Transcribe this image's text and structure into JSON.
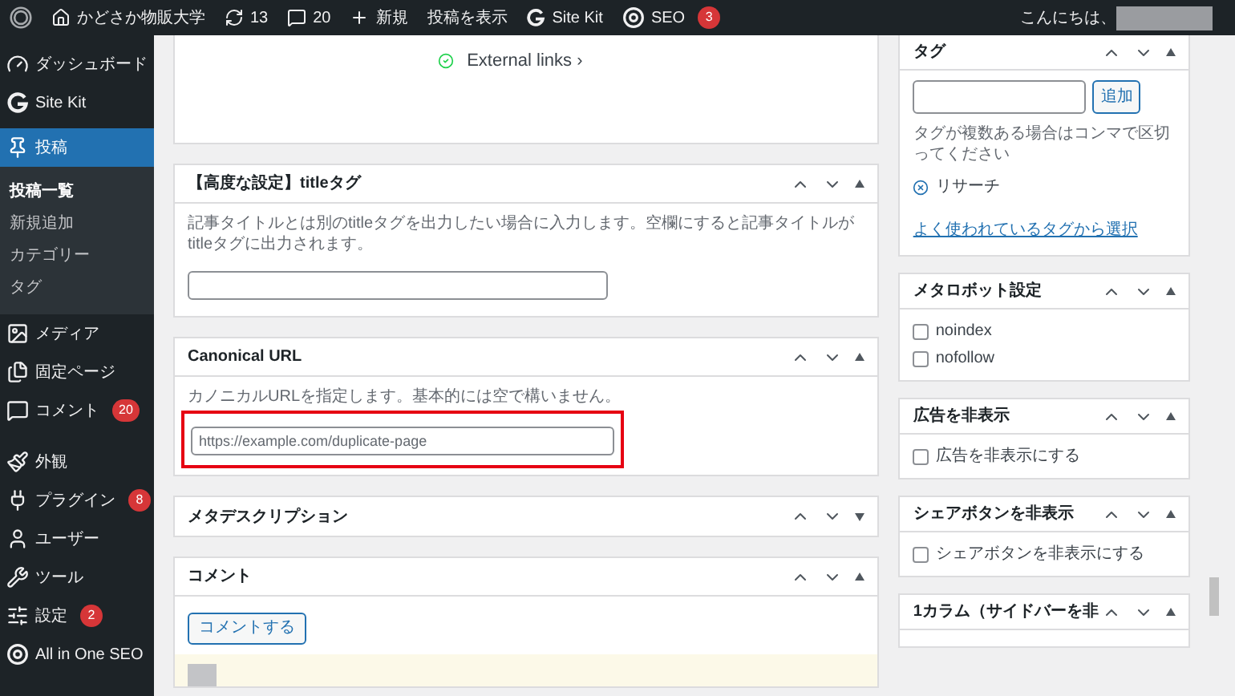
{
  "admin_bar": {
    "site": "かどさか物販大学",
    "updates": "13",
    "comments": "20",
    "new": "新規",
    "view_post": "投稿を表示",
    "site_kit": "Site Kit",
    "seo": "SEO",
    "seo_badge": "3",
    "greeting": "こんにちは、"
  },
  "sidebar": {
    "items": [
      {
        "kind": "dashboard",
        "label": "ダッシュボード",
        "selected": false
      },
      {
        "kind": "sitekit",
        "label": "Site Kit",
        "selected": false
      },
      {
        "kind": "pin",
        "label": "投稿",
        "selected": true,
        "children": [
          {
            "label": "投稿一覧",
            "selected": true
          },
          {
            "label": "新規追加",
            "selected": false
          },
          {
            "label": "カテゴリー",
            "selected": false
          },
          {
            "label": "タグ",
            "selected": false
          }
        ]
      },
      {
        "kind": "media",
        "label": "メディア",
        "selected": false
      },
      {
        "kind": "pages",
        "label": "固定ページ",
        "selected": false
      },
      {
        "kind": "comments",
        "label": "コメント",
        "badge": "20",
        "selected": false
      },
      {
        "kind": "appearance",
        "label": "外観",
        "selected": false
      },
      {
        "kind": "plugins",
        "label": "プラグイン",
        "badge": "8",
        "selected": false
      },
      {
        "kind": "users",
        "label": "ユーザー",
        "selected": false
      },
      {
        "kind": "tools",
        "label": "ツール",
        "selected": false
      },
      {
        "kind": "settings",
        "label": "設定",
        "badge": "2",
        "selected": false
      },
      {
        "kind": "seo",
        "label": "All in One SEO",
        "selected": false
      }
    ]
  },
  "main": {
    "top_link": "External links ›",
    "boxes": [
      {
        "title": "【高度な設定】titleタグ",
        "expanded": true,
        "description": "記事タイトルとは別のtitleタグを出力したい場合に入力します。空欄にすると記事タイトルがtitleタグに出力されます。"
      },
      {
        "title": "Canonical URL",
        "expanded": true,
        "highlighted": true,
        "description": "カノニカルURLを指定します。基本的には空で構いません。",
        "placeholder": "https://example.com/duplicate-page"
      },
      {
        "title": "メタデスクリプション",
        "expanded": false
      },
      {
        "title": "コメント",
        "expanded": true,
        "button": "コメントする"
      }
    ]
  },
  "right": {
    "boxes": [
      {
        "kind": "tags",
        "title": "タグ",
        "add_button": "追加",
        "hint": "タグが複数ある場合はコンマで区切ってください",
        "tag": "リサーチ",
        "link": "よく使われているタグから選択"
      },
      {
        "kind": "checks",
        "title": "メタロボット設定",
        "checks": [
          {
            "label": "noindex",
            "checked": false
          },
          {
            "label": "nofollow",
            "checked": false
          }
        ]
      },
      {
        "kind": "checks",
        "title": "広告を非表示",
        "checks": [
          {
            "label": "広告を非表示にする",
            "checked": false
          }
        ]
      },
      {
        "kind": "checks",
        "title": "シェアボタンを非表示",
        "checks": [
          {
            "label": "シェアボタンを非表示にする",
            "checked": false
          }
        ]
      },
      {
        "kind": "partial",
        "title": "1カラム（サイドバーを非"
      }
    ]
  }
}
